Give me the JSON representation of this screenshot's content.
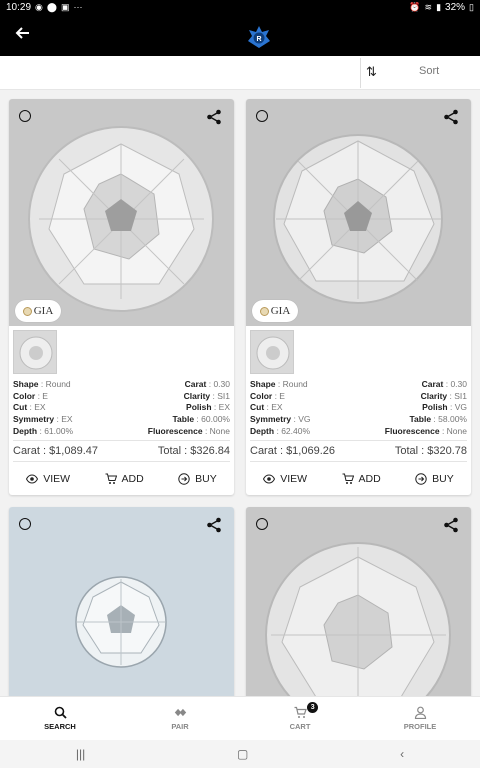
{
  "status": {
    "time": "10:29",
    "battery": "32%",
    "left_icons": [
      "whatsapp-icon",
      "location-icon",
      "gallery-icon",
      "more-icon"
    ],
    "right_icons": [
      "alarm-icon",
      "wifi-icon",
      "signal-icon",
      "battery-icon"
    ]
  },
  "header": {
    "logo_letter": "R"
  },
  "sort": {
    "label": "Sort"
  },
  "cards": [
    {
      "badge": "GIA",
      "shape": "Round",
      "color": "E",
      "cut": "EX",
      "symmetry": "EX",
      "depth": "61.00%",
      "carat": "0.30",
      "clarity": "SI1",
      "polish": "EX",
      "table": "60.00%",
      "fluorescence": "None",
      "price_carat": "Carat : $1,089.47",
      "price_total": "Total : $326.84"
    },
    {
      "badge": "GIA",
      "shape": "Round",
      "color": "E",
      "cut": "EX",
      "symmetry": "VG",
      "depth": "62.40%",
      "carat": "0.30",
      "clarity": "SI1",
      "polish": "VG",
      "table": "58.00%",
      "fluorescence": "None",
      "price_carat": "Carat : $1,069.26",
      "price_total": "Total : $320.78"
    }
  ],
  "labels": {
    "shape": "Shape",
    "color": "Color",
    "cut": "Cut",
    "symmetry": "Symmetry",
    "depth": "Depth",
    "carat": "Carat",
    "clarity": "Clarity",
    "polish": "Polish",
    "table": "Table",
    "fluorescence": "Fluorescence",
    "sep": " : "
  },
  "actions": {
    "view": "VIEW",
    "add": "ADD",
    "buy": "BUY"
  },
  "nav": {
    "search": "SEARCH",
    "pair": "PAIR",
    "cart": "CART",
    "cart_count": "3",
    "profile": "PROFILE",
    "active": "search"
  },
  "system_nav": [
    "recents-icon",
    "home-icon",
    "back-icon"
  ]
}
